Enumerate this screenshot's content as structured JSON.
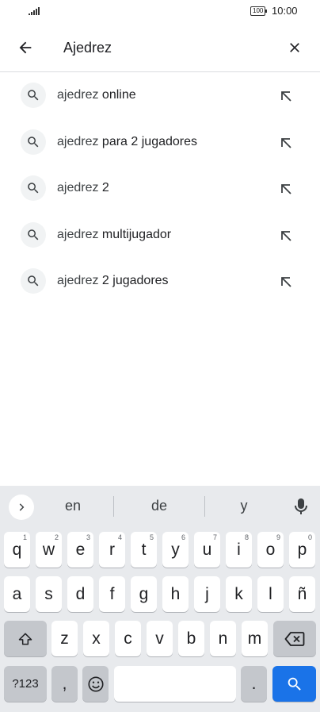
{
  "status": {
    "battery": "100",
    "time": "10:00"
  },
  "search": {
    "query": "Ajedrez"
  },
  "suggestions": [
    {
      "match": "ajedrez",
      "rest": " online"
    },
    {
      "match": "ajedrez",
      "rest": " para 2 jugadores"
    },
    {
      "match": "ajedrez",
      "rest": " 2"
    },
    {
      "match": "ajedrez",
      "rest": " multijugador"
    },
    {
      "match": "ajedrez",
      "rest": " 2 jugadores"
    }
  ],
  "keyboard": {
    "word_suggestions": [
      "en",
      "de",
      "y"
    ],
    "row1": [
      {
        "label": "q",
        "num": "1"
      },
      {
        "label": "w",
        "num": "2"
      },
      {
        "label": "e",
        "num": "3"
      },
      {
        "label": "r",
        "num": "4"
      },
      {
        "label": "t",
        "num": "5"
      },
      {
        "label": "y",
        "num": "6"
      },
      {
        "label": "u",
        "num": "7"
      },
      {
        "label": "i",
        "num": "8"
      },
      {
        "label": "o",
        "num": "9"
      },
      {
        "label": "p",
        "num": "0"
      }
    ],
    "row2": [
      "a",
      "s",
      "d",
      "f",
      "g",
      "h",
      "j",
      "k",
      "l",
      "ñ"
    ],
    "row3": [
      "z",
      "x",
      "c",
      "v",
      "b",
      "n",
      "m"
    ],
    "symbols_label": "?123",
    "comma_label": ",",
    "period_label": "."
  },
  "colors": {
    "accent": "#1a73e8",
    "keyboard_bg": "#e8eaed"
  }
}
